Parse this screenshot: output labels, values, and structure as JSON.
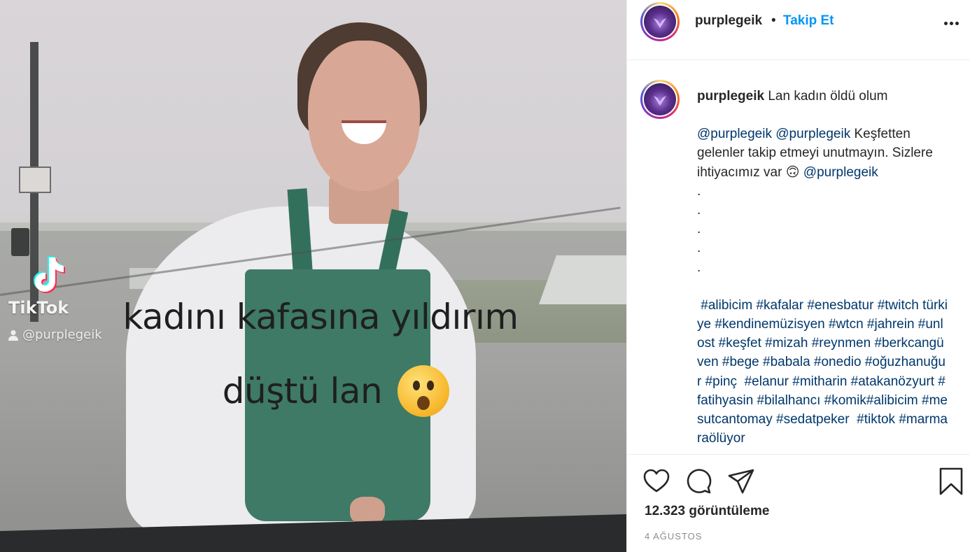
{
  "media": {
    "watermark_brand": "TikTok",
    "watermark_user": "@purplegeik",
    "caption_line1": "kadını kafasına yıldırım",
    "caption_line2": "düştü lan",
    "caption_emoji": "astonished-face-emoji"
  },
  "header": {
    "username": "purplegeik",
    "separator": "•",
    "follow_label": "Takip Et",
    "more_icon": "more-options-icon"
  },
  "comment": {
    "username": "purplegeik",
    "first_line": "Lan kadın öldü olum",
    "mentions": [
      "@purplegeik",
      "@purplegeik"
    ],
    "body": "Keşfetten gelenler takip etmeyi unutmayın. Sizlere ihtiyacımız var",
    "emoji": "🙃",
    "mention_end": "@purplegeik",
    "dots": [
      ".",
      ".",
      ".",
      ".",
      "."
    ],
    "hashtags": " #alibicim #kafalar #enesbatur #twitch türkiye #kendinemüzisyen #wtcn #jahrein #unlost #keşfet #mizah #reynmen #berkcangüven #bege #babala #onedio #oğuzhanuğur #pinç  #elanur #mitharin #atakanözyurt #fatihyasin #bilalhancı #komik#alibicim #mesutcantomay #sedatpeker  #tiktok #marmaraölüyor"
  },
  "actions": {
    "icons": [
      "heart-icon",
      "comment-icon",
      "share-icon",
      "bookmark-icon"
    ],
    "views_count": "12.323",
    "views_label": "görüntüleme",
    "date": "4 AĞUSTOS"
  },
  "colors": {
    "link_blue": "#0095f6",
    "mention_navy": "#00376b",
    "text": "#262626",
    "muted": "#8e8e8e"
  }
}
